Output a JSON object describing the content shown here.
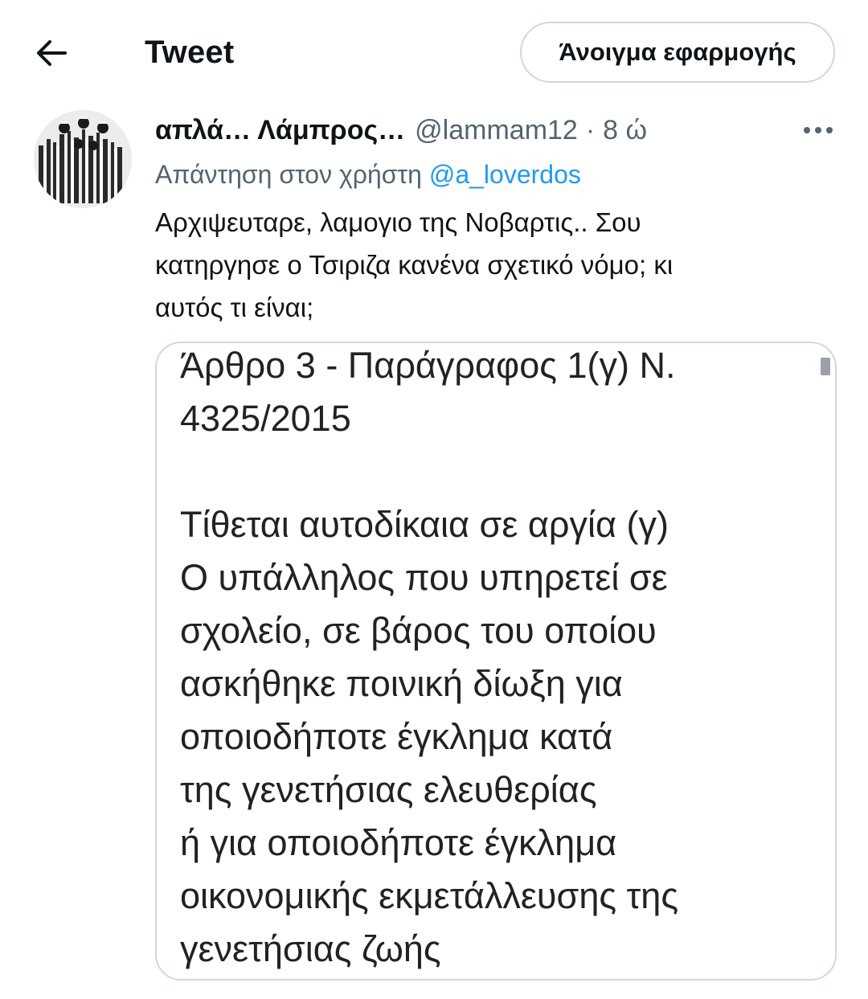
{
  "header": {
    "title": "Tweet",
    "open_app_label": "Άνοιγμα εφαρμογής"
  },
  "tweet": {
    "display_name": "απλά… Λάμπρος…",
    "handle": "@lammam12",
    "separator": "·",
    "time": "8 ώ",
    "reply_prefix": "Απάντηση στον χρήστη",
    "reply_to": "@a_loverdos",
    "text_lines": [
      "Αρχιψευταρε, λαμογιο της Νοβαρτις.. Σου",
      "κατηργησε ο Τσιριζα κανένα σχετικό νόμο; κι",
      "αυτός τι είναι;"
    ],
    "media_text_lines": [
      "Άρθρο 3 - Παράγραφος 1(γ) Ν.",
      "4325/2015",
      "",
      "Τίθεται αυτοδίκαια σε αργία (γ)",
      "Ο υπάλληλος που υπηρετεί σε",
      "σχολείο, σε βάρος του οποίου",
      "ασκήθηκε ποινική δίωξη για",
      "οποιοδήποτε έγκλημα κατά",
      "της γενετήσιας ελευθερίας",
      "ή για οποιοδήποτε έγκλημα",
      "οικονομικής εκμετάλλευσης της",
      "γενετήσιας ζωής"
    ]
  },
  "icons": {
    "back": "arrow-left-icon",
    "more": "more-horizontal-icon"
  },
  "colors": {
    "text": "#0f1419",
    "secondary": "#536471",
    "accent": "#1d9bf0",
    "border": "#cfd9de"
  }
}
